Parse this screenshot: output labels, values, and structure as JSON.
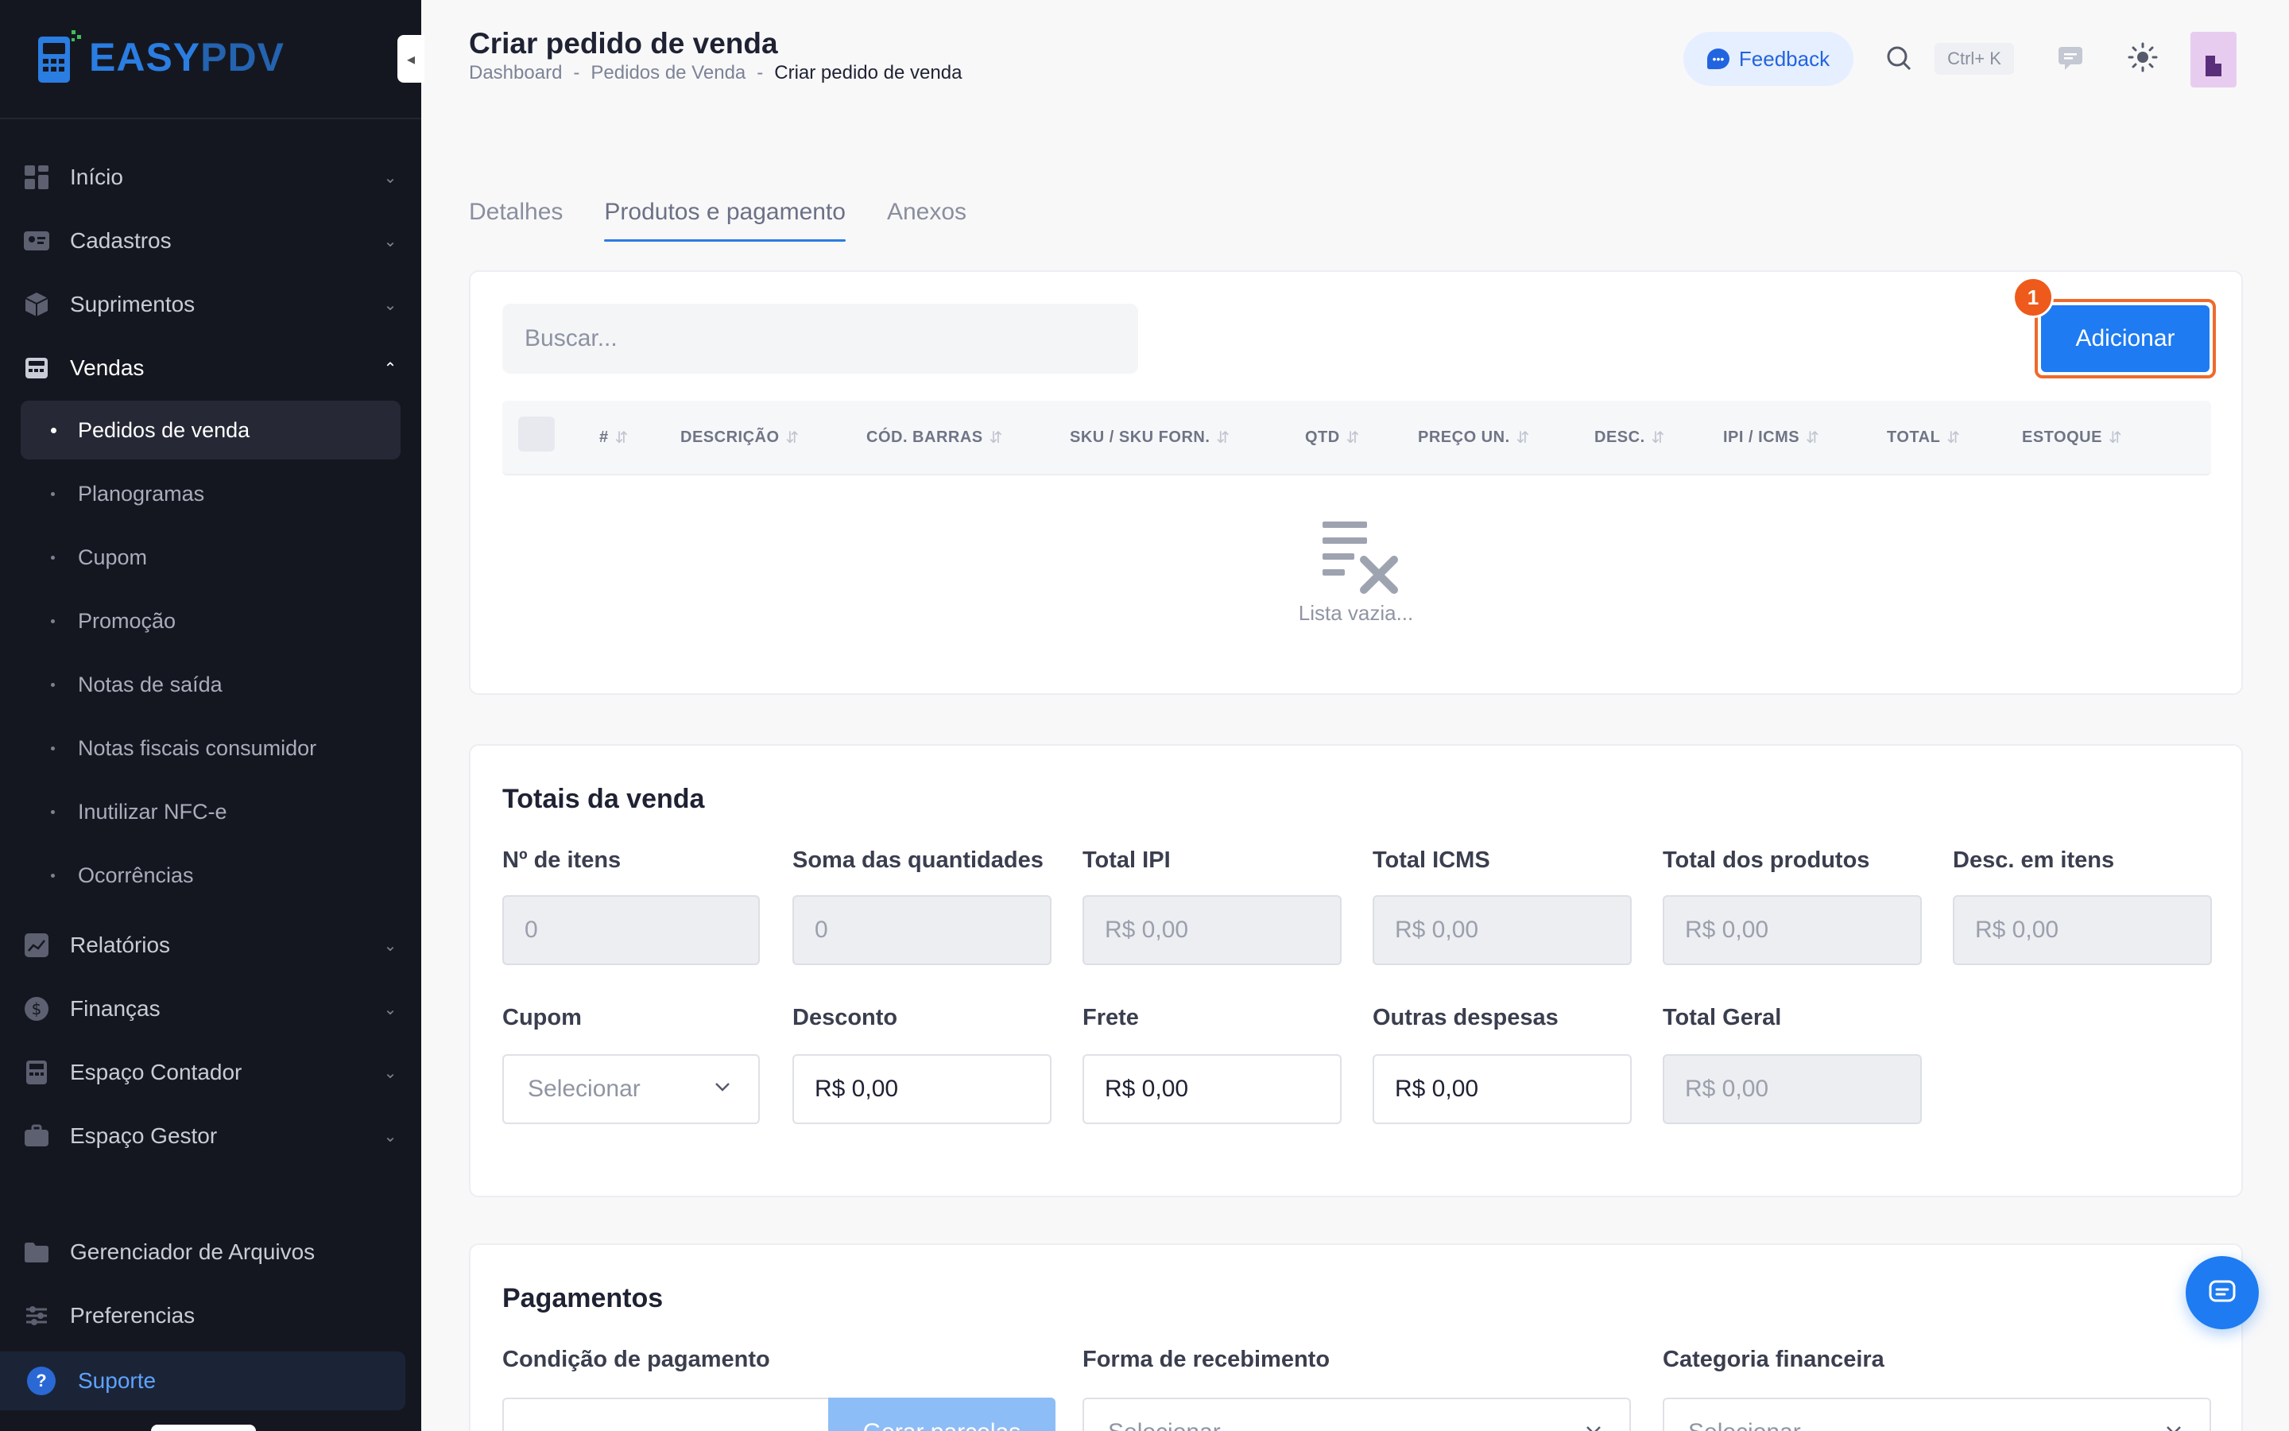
{
  "brand": {
    "part1": "EASY",
    "part2": "PDV"
  },
  "sidebar": {
    "items": [
      {
        "label": "Início",
        "icon": "grid-icon"
      },
      {
        "label": "Cadastros",
        "icon": "id-card-icon"
      },
      {
        "label": "Suprimentos",
        "icon": "box-icon"
      },
      {
        "label": "Vendas",
        "icon": "register-icon"
      }
    ],
    "vendas_sub": [
      "Pedidos de venda",
      "Planogramas",
      "Cupom",
      "Promoção",
      "Notas de saída",
      "Notas fiscais consumidor",
      "Inutilizar NFC-e",
      "Ocorrências"
    ],
    "items2": [
      {
        "label": "Relatórios",
        "icon": "chart-icon"
      },
      {
        "label": "Finanças",
        "icon": "dollar-icon"
      },
      {
        "label": "Espaço Contador",
        "icon": "calculator-icon"
      },
      {
        "label": "Espaço Gestor",
        "icon": "briefcase-icon"
      }
    ],
    "bottom": [
      {
        "label": "Gerenciador de Arquivos",
        "icon": "folder-icon"
      },
      {
        "label": "Preferencias",
        "icon": "sliders-icon"
      }
    ],
    "support": "Suporte"
  },
  "header": {
    "title": "Criar pedido de venda",
    "breadcrumb": [
      "Dashboard",
      "Pedidos de Venda",
      "Criar pedido de venda"
    ],
    "feedback": "Feedback",
    "shortcut": "Ctrl+ K"
  },
  "tabs": [
    "Detalhes",
    "Produtos e pagamento",
    "Anexos"
  ],
  "products": {
    "search_placeholder": "Buscar...",
    "add_label": "Adicionar",
    "badge": "1",
    "columns": [
      "#",
      "DESCRIÇÃO",
      "CÓD. BARRAS",
      "SKU / SKU FORN.",
      "QTD",
      "PREÇO UN.",
      "DESC.",
      "IPI / ICMS",
      "TOTAL",
      "ESTOQUE"
    ],
    "empty": "Lista vazia..."
  },
  "totals": {
    "title": "Totais da venda",
    "row1": [
      {
        "label": "Nº de itens",
        "value": "0"
      },
      {
        "label": "Soma das quantidades",
        "value": "0"
      },
      {
        "label": "Total IPI",
        "value": "R$ 0,00"
      },
      {
        "label": "Total ICMS",
        "value": "R$ 0,00"
      },
      {
        "label": "Total dos produtos",
        "value": "R$ 0,00"
      },
      {
        "label": "Desc. em itens",
        "value": "R$ 0,00"
      }
    ],
    "row2": [
      {
        "label": "Cupom",
        "value": "Selecionar"
      },
      {
        "label": "Desconto",
        "value": "R$ 0,00"
      },
      {
        "label": "Frete",
        "value": "R$ 0,00"
      },
      {
        "label": "Outras despesas",
        "value": "R$ 0,00"
      },
      {
        "label": "Total Geral",
        "value": "R$ 0,00"
      }
    ]
  },
  "payments": {
    "title": "Pagamentos",
    "condicao_label": "Condição de pagamento",
    "gerar_label": "Gerar parcelas",
    "forma_label": "Forma de recebimento",
    "forma_value": "Selecionar",
    "categoria_label": "Categoria financeira",
    "categoria_value": "Selecionar"
  },
  "colors": {
    "accent": "#1e7bf2",
    "highlight": "#ee5a1b",
    "sidebar": "#151720"
  }
}
